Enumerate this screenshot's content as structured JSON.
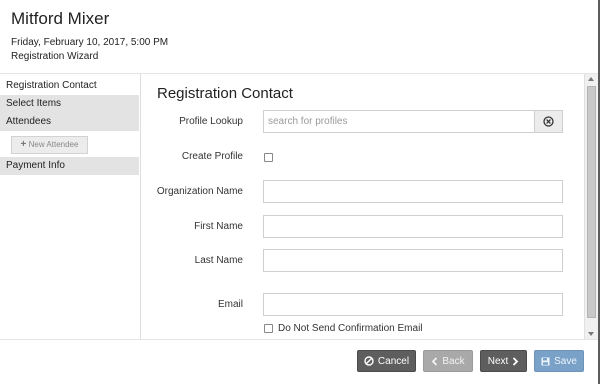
{
  "header": {
    "title": "Mitford Mixer",
    "datetime": "Friday, February 10, 2017, 5:00 PM",
    "wizard_label": "Registration Wizard"
  },
  "sidebar": {
    "items": [
      {
        "label": "Registration Contact",
        "active": true
      },
      {
        "label": "Select Items"
      },
      {
        "label": "Attendees"
      },
      {
        "label": "Payment Info"
      }
    ],
    "new_attendee_label": "New Attendee",
    "new_attendee_icon": "plus-icon"
  },
  "form": {
    "section_title": "Registration Contact",
    "profile_lookup": {
      "label": "Profile Lookup",
      "placeholder": "search for profiles",
      "value": ""
    },
    "clear_icon": "circle-x-icon",
    "create_profile": {
      "label": "Create Profile",
      "checked": false
    },
    "organization_name": {
      "label": "Organization Name",
      "value": ""
    },
    "first_name": {
      "label": "First Name",
      "value": ""
    },
    "last_name": {
      "label": "Last Name",
      "value": ""
    },
    "email": {
      "label": "Email",
      "value": ""
    },
    "no_confirmation": {
      "label": "Do Not Send Confirmation Email",
      "checked": false
    }
  },
  "footer": {
    "cancel_label": "Cancel",
    "back_label": "Back",
    "next_label": "Next",
    "save_label": "Save"
  },
  "colors": {
    "save_accent": "#7aa1c8",
    "dark_button": "#5e5e5e",
    "disabled_button": "#a9a9a9",
    "sidebar_grey": "#e3e3e3"
  }
}
